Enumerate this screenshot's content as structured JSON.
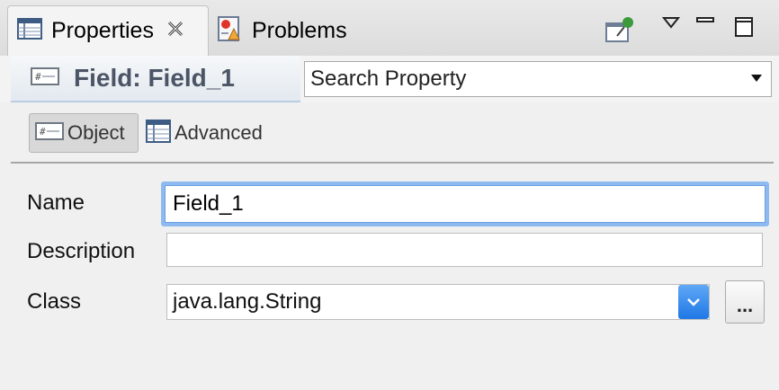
{
  "tabs": [
    {
      "label": "Properties",
      "close": "⮽",
      "active": true
    },
    {
      "label": "Problems",
      "active": false
    }
  ],
  "toolbar": {
    "pin_icon": "pin-icon",
    "menu_icon": "view-menu-icon",
    "minimize_icon": "minimize-icon",
    "maximize_icon": "maximize-icon"
  },
  "header": {
    "title": "Field: Field_1",
    "search": {
      "value": "Search Property"
    }
  },
  "subtabs": [
    {
      "label": "Object",
      "selected": true
    },
    {
      "label": "Advanced",
      "selected": false
    }
  ],
  "form": {
    "name_label": "Name",
    "name_value": "Field_1",
    "description_label": "Description",
    "description_value": "",
    "class_label": "Class",
    "class_value": "java.lang.String",
    "browse_label": "..."
  },
  "colors": {
    "focus_ring": "#8fbaf0",
    "select_arrow": "#1f78e6",
    "title_text": "#4b5566"
  }
}
